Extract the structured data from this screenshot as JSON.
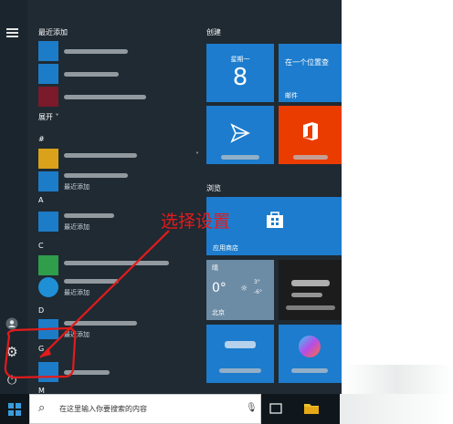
{
  "start_menu": {
    "recent_header": "最近添加",
    "expand_label": "展开",
    "expand_chevron": "˅",
    "recent_added": "最近添加",
    "letters": [
      "#",
      "A",
      "C",
      "D",
      "G",
      "M"
    ]
  },
  "groups": {
    "create": "创建",
    "browse": "浏览"
  },
  "tiles": {
    "calendar": {
      "weekday": "星期一",
      "day": "8"
    },
    "mail": {
      "headline": "在一个位置查",
      "label": "邮件"
    },
    "store": {
      "label": "应用商店"
    },
    "weather": {
      "condition": "晴",
      "temp": "0°",
      "high": "3°",
      "low": "-6°",
      "city": "北京"
    }
  },
  "annotation": {
    "text": "选择设置",
    "color": "#e21b1b"
  },
  "taskbar": {
    "search_placeholder": "在这里输入你要搜索的内容"
  },
  "colors": {
    "tile_blue": "#1d7ccd",
    "office_orange": "#eb3c00",
    "start_bg": "#1f2a33"
  }
}
